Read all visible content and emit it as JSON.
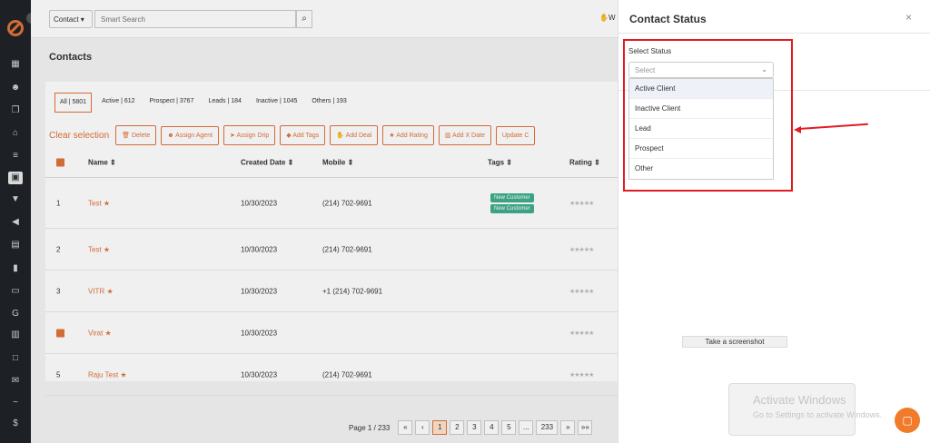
{
  "sidebar": {
    "items": [
      "dashboard",
      "contacts-users",
      "copy",
      "bank",
      "list",
      "contact-book",
      "filter",
      "megaphone",
      "database",
      "chart",
      "folder",
      "google",
      "calendar",
      "calendar2",
      "mail",
      "signature",
      "dollar"
    ]
  },
  "topbar": {
    "contact_select": "Contact",
    "search_placeholder": "Smart Search",
    "user_initial": "W"
  },
  "page": {
    "title": "Contacts"
  },
  "filters": [
    {
      "label": "All",
      "count": "5801"
    },
    {
      "label": "Active",
      "count": "612"
    },
    {
      "label": "Prospect",
      "count": "3767"
    },
    {
      "label": "Leads",
      "count": "184"
    },
    {
      "label": "Inactive",
      "count": "1045"
    },
    {
      "label": "Others",
      "count": "193"
    }
  ],
  "actions": {
    "clear_selection": "Clear selection",
    "buttons": [
      "Delete",
      "Assign Agent",
      "Assign Drip",
      "Add Tags",
      "Add Deal",
      "Add Rating",
      "Add X Date",
      "Update C"
    ]
  },
  "table": {
    "headers": [
      "Name",
      "Created Date",
      "Mobile",
      "Tags",
      "Rating"
    ],
    "rows": [
      {
        "index": "1",
        "name": "Test",
        "date": "10/30/2023",
        "mobile": "(214) 702-9691",
        "tags": [
          "New Customer",
          "New Customer"
        ],
        "rating": "★★★★★"
      },
      {
        "index": "2",
        "name": "Test",
        "date": "10/30/2023",
        "mobile": "(214) 702-9691",
        "tags": [],
        "rating": "★★★★★"
      },
      {
        "index": "3",
        "name": "VITR",
        "date": "10/30/2023",
        "mobile": "+1 (214) 702-9691",
        "tags": [],
        "rating": "★★★★★"
      },
      {
        "index": "",
        "name": "Virat",
        "date": "10/30/2023",
        "mobile": "",
        "tags": [],
        "rating": "★★★★★"
      },
      {
        "index": "5",
        "name": "Raju Test",
        "date": "10/30/2023",
        "mobile": "(214) 702-9691",
        "tags": [],
        "rating": "★★★★★"
      }
    ]
  },
  "pagination": {
    "label": "Page 1 / 233",
    "pages": [
      "«",
      "‹",
      "1",
      "2",
      "3",
      "4",
      "5",
      "...",
      "233",
      "»",
      "»»"
    ]
  },
  "panel": {
    "title": "Contact Status",
    "close": "×",
    "select_label": "Select Status",
    "select_placeholder": "Select",
    "options": [
      "Active Client",
      "Inactive Client",
      "Lead",
      "Prospect",
      "Other"
    ]
  },
  "overlay_text": {
    "screenshot_tip": "Take a screenshot",
    "windows_title": "Activate Windows",
    "windows_sub": "Go to Settings to activate Windows."
  },
  "colors": {
    "accent": "#e0733a",
    "highlight": "#e11b22",
    "tag": "#3fae8c"
  }
}
